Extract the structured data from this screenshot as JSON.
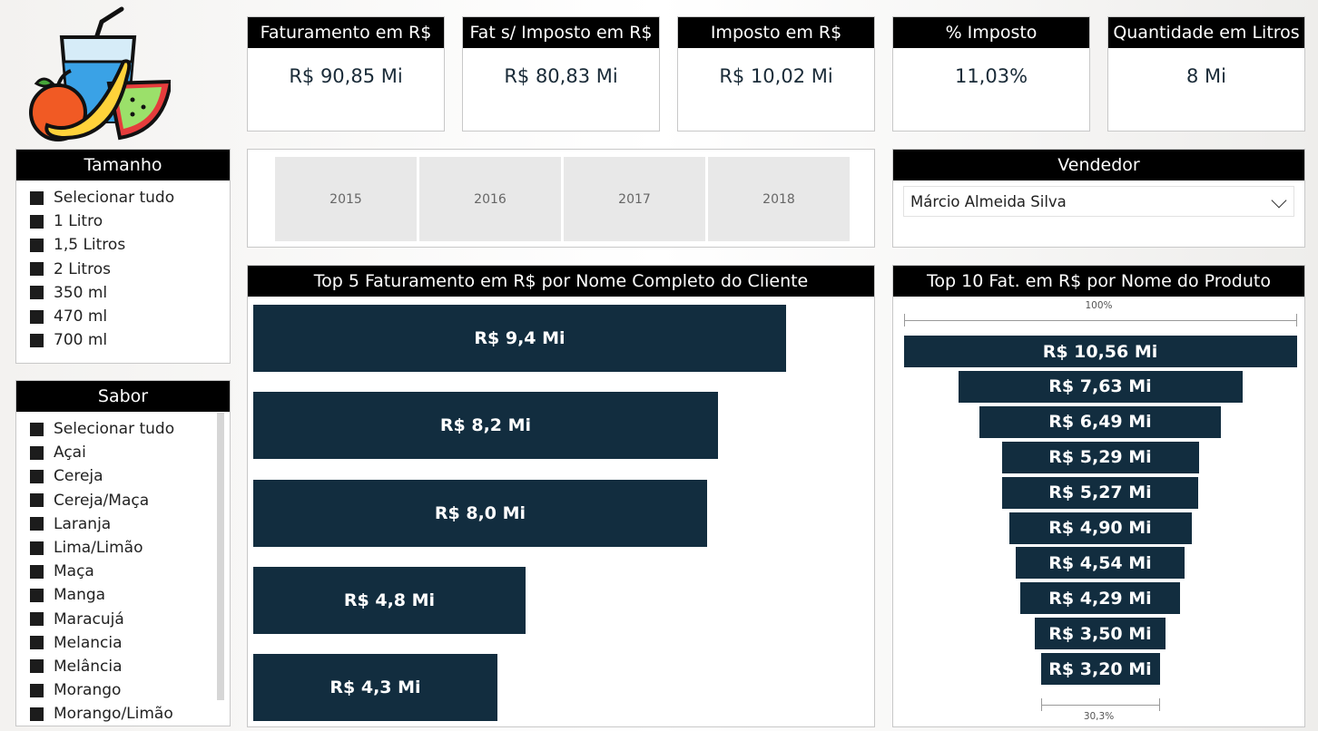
{
  "kpis": [
    {
      "label": "Faturamento em R$",
      "value": "R$ 90,85 Mi"
    },
    {
      "label": "Fat s/ Imposto em R$",
      "value": "R$ 80,83 Mi"
    },
    {
      "label": "Imposto em R$",
      "value": "R$ 10,02 Mi"
    },
    {
      "label": "% Imposto",
      "value": "11,03%"
    },
    {
      "label": "Quantidade em Litros",
      "value": "8 Mi"
    }
  ],
  "tamanho": {
    "title": "Tamanho",
    "items": [
      "Selecionar tudo",
      "1 Litro",
      "1,5 Litros",
      "2 Litros",
      "350 ml",
      "470 ml",
      "700 ml"
    ]
  },
  "sabor": {
    "title": "Sabor",
    "items": [
      "Selecionar tudo",
      "Açai",
      "Cereja",
      "Cereja/Maça",
      "Laranja",
      "Lima/Limão",
      "Maça",
      "Manga",
      "Maracujá",
      "Melancia",
      "Melância",
      "Morango",
      "Morango/Limão"
    ]
  },
  "years": [
    "2015",
    "2016",
    "2017",
    "2018"
  ],
  "vendedor": {
    "title": "Vendedor",
    "selected": "Márcio Almeida Silva"
  },
  "chart_data": [
    {
      "type": "bar",
      "title": "Top 5 Faturamento em R$ por Nome Completo do Cliente",
      "values": [
        9.4,
        8.2,
        8.0,
        4.8,
        4.3
      ],
      "data_labels": [
        "R$ 9,4 Mi",
        "R$ 8,2 Mi",
        "R$ 8,0 Mi",
        "R$ 4,8 Mi",
        "R$ 4,3 Mi"
      ],
      "orientation": "horizontal"
    },
    {
      "type": "funnel",
      "title": "Top 10 Fat. em R$ por Nome do Produto",
      "values": [
        10.56,
        7.63,
        6.49,
        5.29,
        5.27,
        4.9,
        4.54,
        4.29,
        3.5,
        3.2
      ],
      "data_labels": [
        "R$ 10,56 Mi",
        "R$ 7,63 Mi",
        "R$ 6,49 Mi",
        "R$ 5,29 Mi",
        "R$ 5,27 Mi",
        "R$ 4,90 Mi",
        "R$ 4,54 Mi",
        "R$ 4,29 Mi",
        "R$ 3,50 Mi",
        "R$ 3,20 Mi"
      ],
      "top_pct_label": "100%",
      "bottom_pct_label": "30,3%"
    }
  ],
  "colors": {
    "bar": "#122d3f",
    "header": "#000000",
    "tile": "#e8e8e8"
  }
}
